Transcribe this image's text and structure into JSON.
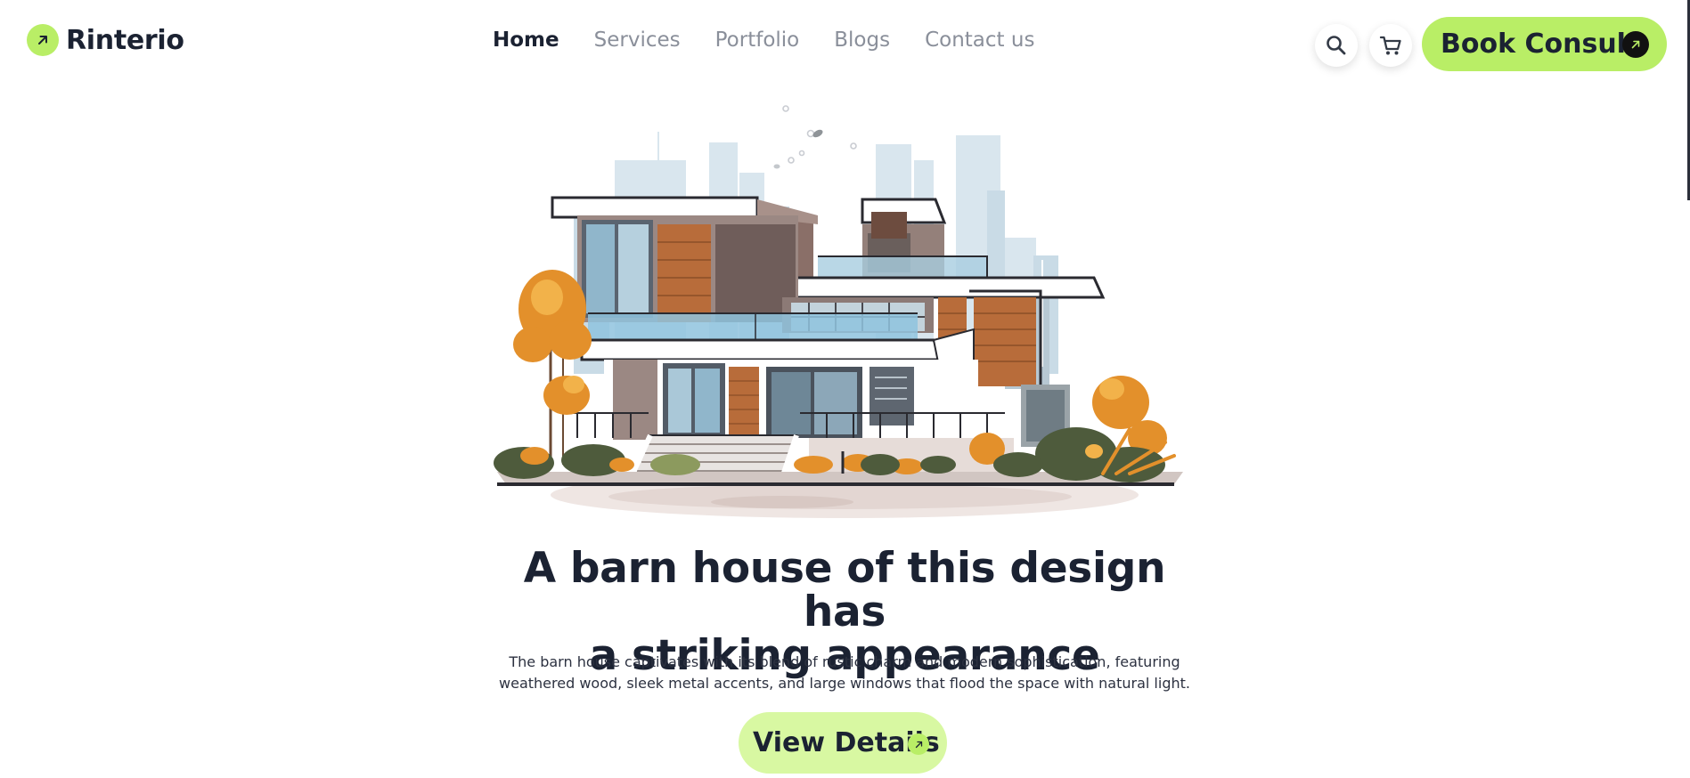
{
  "brand": {
    "name": "Rinterio",
    "accent_color": "#b9ee66",
    "logo_icon": "arrow-up-right-icon"
  },
  "nav": {
    "items": [
      {
        "label": "Home",
        "active": true
      },
      {
        "label": "Services",
        "active": false
      },
      {
        "label": "Portfolio",
        "active": false
      },
      {
        "label": "Blogs",
        "active": false
      },
      {
        "label": "Contact us",
        "active": false
      }
    ]
  },
  "header_actions": {
    "search_icon": "search-icon",
    "cart_icon": "cart-icon",
    "book_consult_label": "Book Consult",
    "book_consult_icon": "arrow-up-right-icon"
  },
  "hero": {
    "image_subject": "modern-house-illustration",
    "title_line1": "A barn house of this design has",
    "title_line2": "a striking appearance",
    "description": "The barn house captivates with its blend of rustic charm and modern sophistication, featuring weathered wood, sleek metal accents, and large windows that flood the space with natural light.",
    "cta_label": "View Details",
    "cta_icon": "arrow-up-right-icon"
  }
}
